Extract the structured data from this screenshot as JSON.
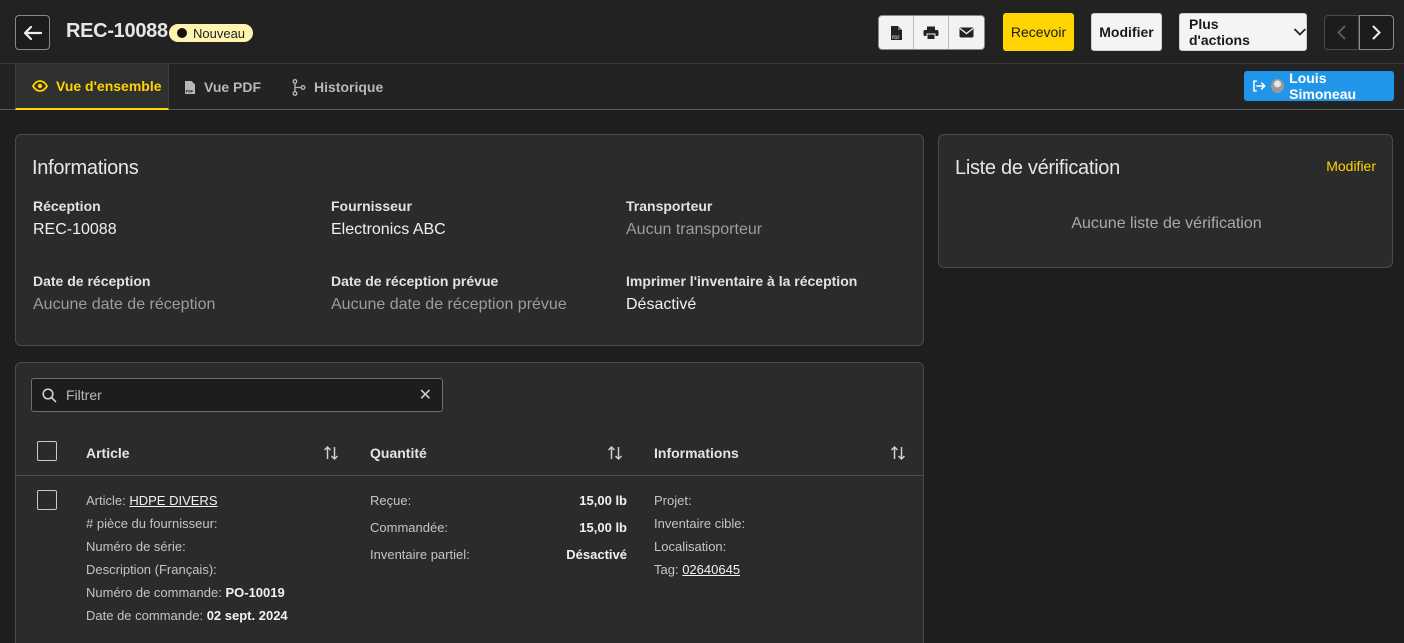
{
  "header": {
    "title": "REC-10088",
    "status": "Nouveau",
    "icons": [
      "pdf-icon",
      "printer-icon",
      "envelope-icon"
    ],
    "receive_label": "Recevoir",
    "modify_label": "Modifier",
    "more_label": "Plus d'actions"
  },
  "tabs": [
    {
      "label": "Vue d'ensemble",
      "icon": "eye-icon",
      "active": true
    },
    {
      "label": "Vue PDF",
      "icon": "pdf-file-icon",
      "active": false
    },
    {
      "label": "Historique",
      "icon": "history-icon",
      "active": false
    }
  ],
  "user": {
    "name": "Louis Simoneau"
  },
  "info": {
    "title": "Informations",
    "fields": [
      {
        "label": "Réception",
        "value": "REC-10088"
      },
      {
        "label": "Fournisseur",
        "value": "Electronics ABC"
      },
      {
        "label": "Transporteur",
        "value": "Aucun transporteur"
      },
      {
        "label": "Date de réception",
        "value": "Aucune date de réception"
      },
      {
        "label": "Date de réception prévue",
        "value": "Aucune date de réception prévue"
      },
      {
        "label": "Imprimer l'inventaire à la réception",
        "value": "Désactivé"
      }
    ]
  },
  "checklist": {
    "title": "Liste de vérification",
    "modify_label": "Modifier",
    "empty_text": "Aucune liste de vérification"
  },
  "items": {
    "filter_placeholder": "Filtrer",
    "columns": [
      "Article",
      "Quantité",
      "Informations"
    ],
    "row": {
      "article_label": "Article:",
      "article_value": "HDPE DIVERS",
      "supplier_part_label": "# pièce du fournisseur:",
      "serial_label": "Numéro de série:",
      "description_label": "Description (Français):",
      "order_number_label": "Numéro de commande:",
      "order_number_value": "PO-10019",
      "order_date_label": "Date de commande:",
      "order_date_value": "02 sept. 2024",
      "received_label": "Reçue:",
      "received_value": "15,00 lb",
      "ordered_label": "Commandée:",
      "ordered_value": "15,00 lb",
      "partial_label": "Inventaire partiel:",
      "partial_value": "Désactivé",
      "project_label": "Projet:",
      "target_inventory_label": "Inventaire cible:",
      "location_label": "Localisation:",
      "tag_label": "Tag:",
      "tag_value": "02640645"
    }
  },
  "colors": {
    "accent": "#ffd400",
    "user_button": "#2196e9",
    "badge_bg": "#fff3b0"
  }
}
